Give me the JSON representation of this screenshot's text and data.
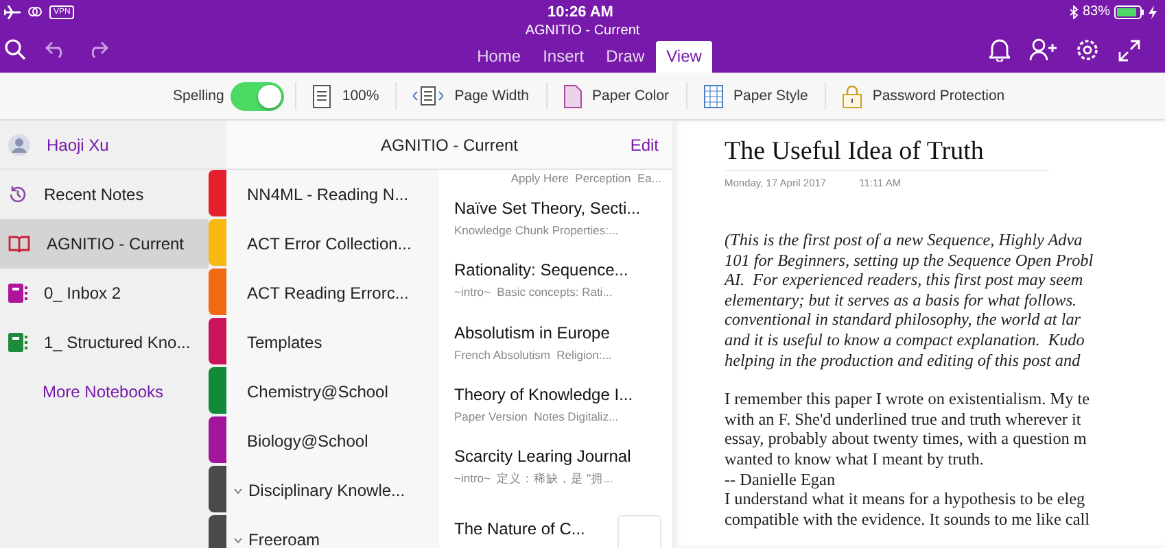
{
  "status_bar": {
    "vpn": "VPN",
    "time": "10:26 AM",
    "battery": "83%"
  },
  "window": {
    "title": "AGNITIO - Current"
  },
  "tabs": [
    {
      "label": "Home",
      "selected": false
    },
    {
      "label": "Insert",
      "selected": false
    },
    {
      "label": "Draw",
      "selected": false
    },
    {
      "label": "View",
      "selected": true
    }
  ],
  "toolbar": [
    {
      "kind": "toggle",
      "label": "Spelling",
      "on": true
    },
    {
      "kind": "zoom",
      "label": "100%"
    },
    {
      "kind": "width",
      "label": "Page Width"
    },
    {
      "kind": "color",
      "label": "Paper Color"
    },
    {
      "kind": "style",
      "label": "Paper Style"
    },
    {
      "kind": "lock",
      "label": "Password Protection"
    }
  ],
  "account": {
    "name": "Haoji Xu"
  },
  "notebooks": [
    {
      "kind": "recent",
      "label": "Recent Notes",
      "selected": false,
      "color": "#8a4aa8"
    },
    {
      "kind": "open",
      "label": "AGNITIO - Current",
      "selected": true,
      "color": "#c8203a"
    },
    {
      "kind": "notebook",
      "label": "0_ Inbox 2",
      "selected": false,
      "color": "#b0139c"
    },
    {
      "kind": "notebook",
      "label": "1_ Structured Kno...",
      "selected": false,
      "color": "#1e8a3c"
    }
  ],
  "more_notebooks": "More Notebooks",
  "sections_header": {
    "title": "AGNITIO - Current",
    "edit": "Edit"
  },
  "sections": [
    {
      "kind": "section",
      "label": "NN4ML - Reading N...",
      "color": "#e3202b"
    },
    {
      "kind": "section",
      "label": "ACT Error Collection...",
      "color": "#f7b910"
    },
    {
      "kind": "section",
      "label": "ACT Reading Errorc...",
      "color": "#f06a12"
    },
    {
      "kind": "section",
      "label": "Templates",
      "color": "#c9135a"
    },
    {
      "kind": "section",
      "label": "Chemistry@School",
      "color": "#128a3a"
    },
    {
      "kind": "section",
      "label": "Biology@School",
      "color": "#a3169c"
    },
    {
      "kind": "group",
      "label": "Disciplinary Knowle...",
      "color": "#4a4a4a",
      "expanded": false
    },
    {
      "kind": "group",
      "label": "Freeroam",
      "color": "#4a4a4a",
      "expanded": false
    }
  ],
  "pages": [
    {
      "subtitle": "Apply Here  Perception  Ea..."
    },
    {
      "title": "Naïve Set Theory, Secti...",
      "subtitle": "Knowledge Chunk Properties:..."
    },
    {
      "title": "Rationality: Sequence...",
      "subtitle": "~intro~  Basic concepts: Rati..."
    },
    {
      "title": "Absolutism in Europe",
      "subtitle": "French Absolutism  Religion:..."
    },
    {
      "title": "Theory of Knowledge I...",
      "subtitle": "Paper Version  Notes Digitaliz..."
    },
    {
      "title": "Scarcity Learing Journal",
      "subtitle": "~intro~  定义：稀缺，是 \"拥..."
    },
    {
      "title": "The Nature of C...",
      "thumbnail": true
    }
  ],
  "note": {
    "title": "The Useful Idea of Truth",
    "date": "Monday, 17 April 2017",
    "time": "11:11 AM",
    "paragraphs": [
      {
        "kind": "italic",
        "lines": [
          "(This is the first post of a new Sequence, Highly Adva",
          "101 for Beginners, setting up the Sequence Open Probl",
          "AI.  For experienced readers, this first post may seem",
          "elementary; but it serves as a basis for what follows.",
          "conventional in standard philosophy, the world at lar",
          "and it is useful to know a compact explanation.  Kudo",
          "helping in the production and editing of this post and"
        ]
      },
      {
        "kind": "plain",
        "lines": [
          "I remember this paper I wrote on existentialism. My te",
          "with an F. She'd underlined true and truth wherever it",
          "essay, probably about twenty times, with a question m",
          "wanted to know what I meant by truth.",
          "-- Danielle Egan",
          "I understand what it means for a hypothesis to be eleg",
          "compatible with the evidence. It sounds to me like call"
        ]
      }
    ]
  }
}
